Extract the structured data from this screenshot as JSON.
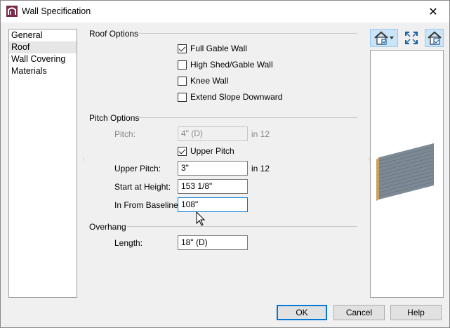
{
  "window": {
    "title": "Wall Specification",
    "close_glyph": "✕"
  },
  "sidebar": {
    "items": [
      {
        "label": "General"
      },
      {
        "label": "Roof"
      },
      {
        "label": "Wall Covering"
      },
      {
        "label": "Materials"
      }
    ],
    "selected": "Roof"
  },
  "roof_options": {
    "heading": "Roof Options",
    "checkboxes": [
      {
        "label": "Full Gable Wall",
        "checked": true
      },
      {
        "label": "High Shed/Gable Wall",
        "checked": false
      },
      {
        "label": "Knee Wall",
        "checked": false
      },
      {
        "label": "Extend Slope Downward",
        "checked": false
      }
    ]
  },
  "pitch_options": {
    "heading": "Pitch Options",
    "pitch_label": "Pitch:",
    "pitch_value": "4\" (D)",
    "pitch_suffix": "in 12",
    "upper_pitch_checkbox": {
      "label": "Upper Pitch",
      "checked": true
    },
    "upper_pitch_label": "Upper Pitch:",
    "upper_pitch_value": "3\"",
    "upper_pitch_suffix": "in 12",
    "start_height_label": "Start at Height:",
    "start_height_value": "153 1/8\"",
    "baseline_label": "In From Baseline:",
    "baseline_value": "108\""
  },
  "overhang": {
    "heading": "Overhang",
    "length_label": "Length:",
    "length_value": "18\" (D)"
  },
  "buttons": {
    "ok": "OK",
    "cancel": "Cancel",
    "help": "Help"
  },
  "icons": {
    "app": "wall-spec-app-icon",
    "view_mode": "house-view-icon",
    "fit": "fit-window-icon",
    "preview_options": "house-check-icon"
  },
  "colors": {
    "accent": "#0078d7",
    "selected_item": "#e6e6e6",
    "active_tool": "#cce4f7"
  }
}
